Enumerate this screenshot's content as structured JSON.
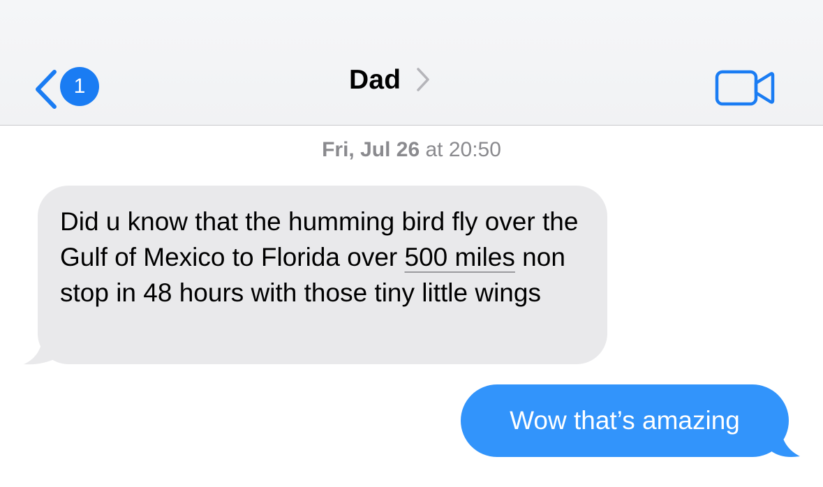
{
  "header": {
    "unread_count": "1",
    "contact_name": "Dad",
    "icons": {
      "back": "chevron-left-icon",
      "contact_details": "chevron-right-icon",
      "video": "video-camera-icon"
    }
  },
  "conversation": {
    "timestamp_day": "Fri, Jul 26",
    "timestamp_time": "at 20:50",
    "messages": [
      {
        "direction": "incoming",
        "text_before": "Did u know that the humming bird fly over the Gulf of Mexico to Florida over ",
        "detected_link": "500 miles",
        "text_after": " non stop in 48 hours with those tiny little wings"
      },
      {
        "direction": "outgoing",
        "text": "Wow that’s amazing"
      }
    ]
  },
  "colors": {
    "accent": "#1a7cf3",
    "outgoing_bubble": "#3294fb",
    "incoming_bubble": "#e9e9eb",
    "timestamp": "#8a8a8e"
  }
}
